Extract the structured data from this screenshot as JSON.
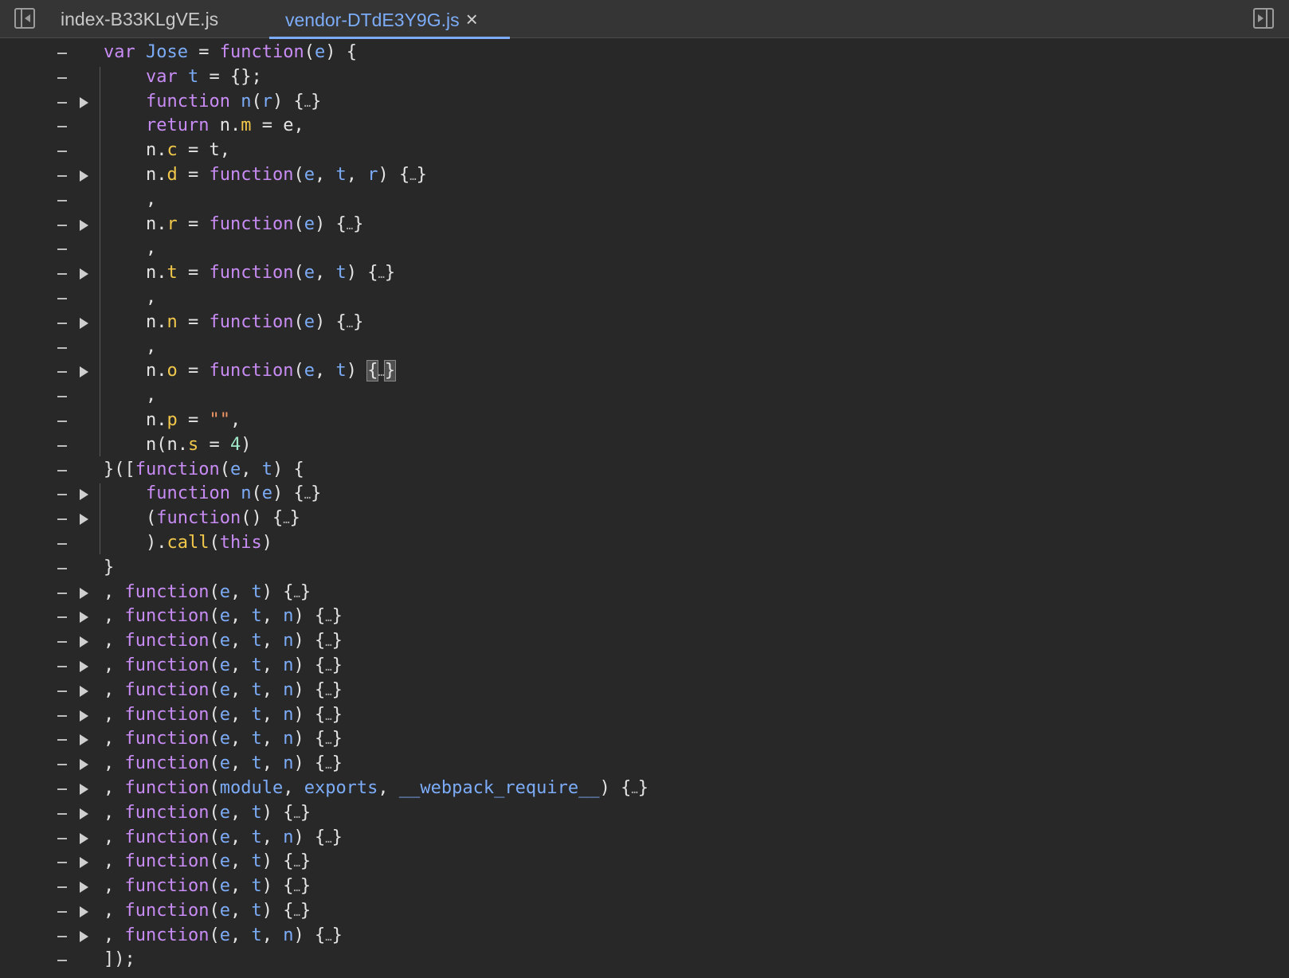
{
  "tabs": [
    {
      "label": "index-B33KLgVE.js",
      "active": false
    },
    {
      "label": "vendor-DTdE3Y9G.js",
      "active": true,
      "close": "×"
    }
  ],
  "icons": {
    "left": "sidebar-toggle-left-icon",
    "right": "sidebar-toggle-right-icon"
  },
  "colors": {
    "keyword": "#c88cf4",
    "identifier": "#7cacf8",
    "property": "#f2c84b",
    "string": "#f29766",
    "number": "#a0e7c8",
    "accent": "#7cacf8"
  },
  "code_lines": [
    {
      "indent": 0,
      "fold": false,
      "tokens": [
        [
          "kw",
          "var"
        ],
        [
          "pun",
          " "
        ],
        [
          "fn",
          "Jose"
        ],
        [
          "pun",
          " = "
        ],
        [
          "kw",
          "function"
        ],
        [
          "pun",
          "("
        ],
        [
          "prm",
          "e"
        ],
        [
          "pun",
          ") {"
        ]
      ]
    },
    {
      "indent": 1,
      "fold": false,
      "tokens": [
        [
          "kw",
          "var"
        ],
        [
          "pun",
          " "
        ],
        [
          "prm",
          "t"
        ],
        [
          "pun",
          " = {};"
        ]
      ]
    },
    {
      "indent": 1,
      "fold": true,
      "tokens": [
        [
          "kw",
          "function"
        ],
        [
          "pun",
          " "
        ],
        [
          "fn",
          "n"
        ],
        [
          "pun",
          "("
        ],
        [
          "prm",
          "r"
        ],
        [
          "pun",
          ") {"
        ],
        [
          "ell",
          "…"
        ],
        [
          "pun",
          "}"
        ]
      ]
    },
    {
      "indent": 1,
      "fold": false,
      "tokens": [
        [
          "kw",
          "return"
        ],
        [
          "pun",
          " n."
        ],
        [
          "prop",
          "m"
        ],
        [
          "pun",
          " = e,"
        ]
      ]
    },
    {
      "indent": 1,
      "fold": false,
      "tokens": [
        [
          "pun",
          "n."
        ],
        [
          "prop",
          "c"
        ],
        [
          "pun",
          " = t,"
        ]
      ]
    },
    {
      "indent": 1,
      "fold": true,
      "tokens": [
        [
          "pun",
          "n."
        ],
        [
          "prop",
          "d"
        ],
        [
          "pun",
          " = "
        ],
        [
          "kw",
          "function"
        ],
        [
          "pun",
          "("
        ],
        [
          "prm",
          "e"
        ],
        [
          "pun",
          ", "
        ],
        [
          "prm",
          "t"
        ],
        [
          "pun",
          ", "
        ],
        [
          "prm",
          "r"
        ],
        [
          "pun",
          ") {"
        ],
        [
          "ell",
          "…"
        ],
        [
          "pun",
          "}"
        ]
      ]
    },
    {
      "indent": 1,
      "fold": false,
      "tokens": [
        [
          "pun",
          ","
        ]
      ]
    },
    {
      "indent": 1,
      "fold": true,
      "tokens": [
        [
          "pun",
          "n."
        ],
        [
          "prop",
          "r"
        ],
        [
          "pun",
          " = "
        ],
        [
          "kw",
          "function"
        ],
        [
          "pun",
          "("
        ],
        [
          "prm",
          "e"
        ],
        [
          "pun",
          ") {"
        ],
        [
          "ell",
          "…"
        ],
        [
          "pun",
          "}"
        ]
      ]
    },
    {
      "indent": 1,
      "fold": false,
      "tokens": [
        [
          "pun",
          ","
        ]
      ]
    },
    {
      "indent": 1,
      "fold": true,
      "tokens": [
        [
          "pun",
          "n."
        ],
        [
          "prop",
          "t"
        ],
        [
          "pun",
          " = "
        ],
        [
          "kw",
          "function"
        ],
        [
          "pun",
          "("
        ],
        [
          "prm",
          "e"
        ],
        [
          "pun",
          ", "
        ],
        [
          "prm",
          "t"
        ],
        [
          "pun",
          ") {"
        ],
        [
          "ell",
          "…"
        ],
        [
          "pun",
          "}"
        ]
      ]
    },
    {
      "indent": 1,
      "fold": false,
      "tokens": [
        [
          "pun",
          ","
        ]
      ]
    },
    {
      "indent": 1,
      "fold": true,
      "tokens": [
        [
          "pun",
          "n."
        ],
        [
          "prop",
          "n"
        ],
        [
          "pun",
          " = "
        ],
        [
          "kw",
          "function"
        ],
        [
          "pun",
          "("
        ],
        [
          "prm",
          "e"
        ],
        [
          "pun",
          ") {"
        ],
        [
          "ell",
          "…"
        ],
        [
          "pun",
          "}"
        ]
      ]
    },
    {
      "indent": 1,
      "fold": false,
      "tokens": [
        [
          "pun",
          ","
        ]
      ]
    },
    {
      "indent": 1,
      "fold": true,
      "tokens": [
        [
          "pun",
          "n."
        ],
        [
          "prop",
          "o"
        ],
        [
          "pun",
          " = "
        ],
        [
          "kw",
          "function"
        ],
        [
          "pun",
          "("
        ],
        [
          "prm",
          "e"
        ],
        [
          "pun",
          ", "
        ],
        [
          "prm",
          "t"
        ],
        [
          "pun",
          ") "
        ],
        [
          "hl",
          "{"
        ],
        [
          "ell",
          "…"
        ],
        [
          "hl",
          "}"
        ]
      ]
    },
    {
      "indent": 1,
      "fold": false,
      "tokens": [
        [
          "pun",
          ","
        ]
      ]
    },
    {
      "indent": 1,
      "fold": false,
      "tokens": [
        [
          "pun",
          "n."
        ],
        [
          "prop",
          "p"
        ],
        [
          "pun",
          " = "
        ],
        [
          "str",
          "\"\""
        ],
        [
          "pun",
          ","
        ]
      ]
    },
    {
      "indent": 1,
      "fold": false,
      "tokens": [
        [
          "pun",
          "n(n."
        ],
        [
          "prop",
          "s"
        ],
        [
          "pun",
          " = "
        ],
        [
          "num",
          "4"
        ],
        [
          "pun",
          ")"
        ]
      ]
    },
    {
      "indent": 0,
      "fold": false,
      "tokens": [
        [
          "pun",
          "}(["
        ],
        [
          "kw",
          "function"
        ],
        [
          "pun",
          "("
        ],
        [
          "prm",
          "e"
        ],
        [
          "pun",
          ", "
        ],
        [
          "prm",
          "t"
        ],
        [
          "pun",
          ") {"
        ]
      ]
    },
    {
      "indent": 1,
      "fold": true,
      "tokens": [
        [
          "kw",
          "function"
        ],
        [
          "pun",
          " "
        ],
        [
          "fn",
          "n"
        ],
        [
          "pun",
          "("
        ],
        [
          "prm",
          "e"
        ],
        [
          "pun",
          ") {"
        ],
        [
          "ell",
          "…"
        ],
        [
          "pun",
          "}"
        ]
      ]
    },
    {
      "indent": 1,
      "fold": true,
      "tokens": [
        [
          "pun",
          "("
        ],
        [
          "kw",
          "function"
        ],
        [
          "pun",
          "() {"
        ],
        [
          "ell",
          "…"
        ],
        [
          "pun",
          "}"
        ]
      ]
    },
    {
      "indent": 1,
      "fold": false,
      "tokens": [
        [
          "pun",
          ")."
        ],
        [
          "prop",
          "call"
        ],
        [
          "pun",
          "("
        ],
        [
          "kw",
          "this"
        ],
        [
          "pun",
          ")"
        ]
      ]
    },
    {
      "indent": 0,
      "fold": false,
      "tokens": [
        [
          "pun",
          "}"
        ]
      ]
    },
    {
      "indent": 0,
      "fold": true,
      "tokens": [
        [
          "pun",
          ", "
        ],
        [
          "kw",
          "function"
        ],
        [
          "pun",
          "("
        ],
        [
          "prm",
          "e"
        ],
        [
          "pun",
          ", "
        ],
        [
          "prm",
          "t"
        ],
        [
          "pun",
          ") {"
        ],
        [
          "ell",
          "…"
        ],
        [
          "pun",
          "}"
        ]
      ]
    },
    {
      "indent": 0,
      "fold": true,
      "tokens": [
        [
          "pun",
          ", "
        ],
        [
          "kw",
          "function"
        ],
        [
          "pun",
          "("
        ],
        [
          "prm",
          "e"
        ],
        [
          "pun",
          ", "
        ],
        [
          "prm",
          "t"
        ],
        [
          "pun",
          ", "
        ],
        [
          "prm",
          "n"
        ],
        [
          "pun",
          ") {"
        ],
        [
          "ell",
          "…"
        ],
        [
          "pun",
          "}"
        ]
      ]
    },
    {
      "indent": 0,
      "fold": true,
      "tokens": [
        [
          "pun",
          ", "
        ],
        [
          "kw",
          "function"
        ],
        [
          "pun",
          "("
        ],
        [
          "prm",
          "e"
        ],
        [
          "pun",
          ", "
        ],
        [
          "prm",
          "t"
        ],
        [
          "pun",
          ", "
        ],
        [
          "prm",
          "n"
        ],
        [
          "pun",
          ") {"
        ],
        [
          "ell",
          "…"
        ],
        [
          "pun",
          "}"
        ]
      ]
    },
    {
      "indent": 0,
      "fold": true,
      "tokens": [
        [
          "pun",
          ", "
        ],
        [
          "kw",
          "function"
        ],
        [
          "pun",
          "("
        ],
        [
          "prm",
          "e"
        ],
        [
          "pun",
          ", "
        ],
        [
          "prm",
          "t"
        ],
        [
          "pun",
          ", "
        ],
        [
          "prm",
          "n"
        ],
        [
          "pun",
          ") {"
        ],
        [
          "ell",
          "…"
        ],
        [
          "pun",
          "}"
        ]
      ]
    },
    {
      "indent": 0,
      "fold": true,
      "tokens": [
        [
          "pun",
          ", "
        ],
        [
          "kw",
          "function"
        ],
        [
          "pun",
          "("
        ],
        [
          "prm",
          "e"
        ],
        [
          "pun",
          ", "
        ],
        [
          "prm",
          "t"
        ],
        [
          "pun",
          ", "
        ],
        [
          "prm",
          "n"
        ],
        [
          "pun",
          ") {"
        ],
        [
          "ell",
          "…"
        ],
        [
          "pun",
          "}"
        ]
      ]
    },
    {
      "indent": 0,
      "fold": true,
      "tokens": [
        [
          "pun",
          ", "
        ],
        [
          "kw",
          "function"
        ],
        [
          "pun",
          "("
        ],
        [
          "prm",
          "e"
        ],
        [
          "pun",
          ", "
        ],
        [
          "prm",
          "t"
        ],
        [
          "pun",
          ", "
        ],
        [
          "prm",
          "n"
        ],
        [
          "pun",
          ") {"
        ],
        [
          "ell",
          "…"
        ],
        [
          "pun",
          "}"
        ]
      ]
    },
    {
      "indent": 0,
      "fold": true,
      "tokens": [
        [
          "pun",
          ", "
        ],
        [
          "kw",
          "function"
        ],
        [
          "pun",
          "("
        ],
        [
          "prm",
          "e"
        ],
        [
          "pun",
          ", "
        ],
        [
          "prm",
          "t"
        ],
        [
          "pun",
          ", "
        ],
        [
          "prm",
          "n"
        ],
        [
          "pun",
          ") {"
        ],
        [
          "ell",
          "…"
        ],
        [
          "pun",
          "}"
        ]
      ]
    },
    {
      "indent": 0,
      "fold": true,
      "tokens": [
        [
          "pun",
          ", "
        ],
        [
          "kw",
          "function"
        ],
        [
          "pun",
          "("
        ],
        [
          "prm",
          "e"
        ],
        [
          "pun",
          ", "
        ],
        [
          "prm",
          "t"
        ],
        [
          "pun",
          ", "
        ],
        [
          "prm",
          "n"
        ],
        [
          "pun",
          ") {"
        ],
        [
          "ell",
          "…"
        ],
        [
          "pun",
          "}"
        ]
      ]
    },
    {
      "indent": 0,
      "fold": true,
      "tokens": [
        [
          "pun",
          ", "
        ],
        [
          "kw",
          "function"
        ],
        [
          "pun",
          "("
        ],
        [
          "prm",
          "module"
        ],
        [
          "pun",
          ", "
        ],
        [
          "prm",
          "exports"
        ],
        [
          "pun",
          ", "
        ],
        [
          "prm",
          "__webpack_require__"
        ],
        [
          "pun",
          ") {"
        ],
        [
          "ell",
          "…"
        ],
        [
          "pun",
          "}"
        ]
      ]
    },
    {
      "indent": 0,
      "fold": true,
      "tokens": [
        [
          "pun",
          ", "
        ],
        [
          "kw",
          "function"
        ],
        [
          "pun",
          "("
        ],
        [
          "prm",
          "e"
        ],
        [
          "pun",
          ", "
        ],
        [
          "prm",
          "t"
        ],
        [
          "pun",
          ") {"
        ],
        [
          "ell",
          "…"
        ],
        [
          "pun",
          "}"
        ]
      ]
    },
    {
      "indent": 0,
      "fold": true,
      "tokens": [
        [
          "pun",
          ", "
        ],
        [
          "kw",
          "function"
        ],
        [
          "pun",
          "("
        ],
        [
          "prm",
          "e"
        ],
        [
          "pun",
          ", "
        ],
        [
          "prm",
          "t"
        ],
        [
          "pun",
          ", "
        ],
        [
          "prm",
          "n"
        ],
        [
          "pun",
          ") {"
        ],
        [
          "ell",
          "…"
        ],
        [
          "pun",
          "}"
        ]
      ]
    },
    {
      "indent": 0,
      "fold": true,
      "tokens": [
        [
          "pun",
          ", "
        ],
        [
          "kw",
          "function"
        ],
        [
          "pun",
          "("
        ],
        [
          "prm",
          "e"
        ],
        [
          "pun",
          ", "
        ],
        [
          "prm",
          "t"
        ],
        [
          "pun",
          ") {"
        ],
        [
          "ell",
          "…"
        ],
        [
          "pun",
          "}"
        ]
      ]
    },
    {
      "indent": 0,
      "fold": true,
      "tokens": [
        [
          "pun",
          ", "
        ],
        [
          "kw",
          "function"
        ],
        [
          "pun",
          "("
        ],
        [
          "prm",
          "e"
        ],
        [
          "pun",
          ", "
        ],
        [
          "prm",
          "t"
        ],
        [
          "pun",
          ") {"
        ],
        [
          "ell",
          "…"
        ],
        [
          "pun",
          "}"
        ]
      ]
    },
    {
      "indent": 0,
      "fold": true,
      "tokens": [
        [
          "pun",
          ", "
        ],
        [
          "kw",
          "function"
        ],
        [
          "pun",
          "("
        ],
        [
          "prm",
          "e"
        ],
        [
          "pun",
          ", "
        ],
        [
          "prm",
          "t"
        ],
        [
          "pun",
          ") {"
        ],
        [
          "ell",
          "…"
        ],
        [
          "pun",
          "}"
        ]
      ]
    },
    {
      "indent": 0,
      "fold": true,
      "tokens": [
        [
          "pun",
          ", "
        ],
        [
          "kw",
          "function"
        ],
        [
          "pun",
          "("
        ],
        [
          "prm",
          "e"
        ],
        [
          "pun",
          ", "
        ],
        [
          "prm",
          "t"
        ],
        [
          "pun",
          ", "
        ],
        [
          "prm",
          "n"
        ],
        [
          "pun",
          ") {"
        ],
        [
          "ell",
          "…"
        ],
        [
          "pun",
          "}"
        ]
      ]
    },
    {
      "indent": 0,
      "fold": false,
      "tokens": [
        [
          "pun",
          "]);"
        ]
      ]
    }
  ]
}
